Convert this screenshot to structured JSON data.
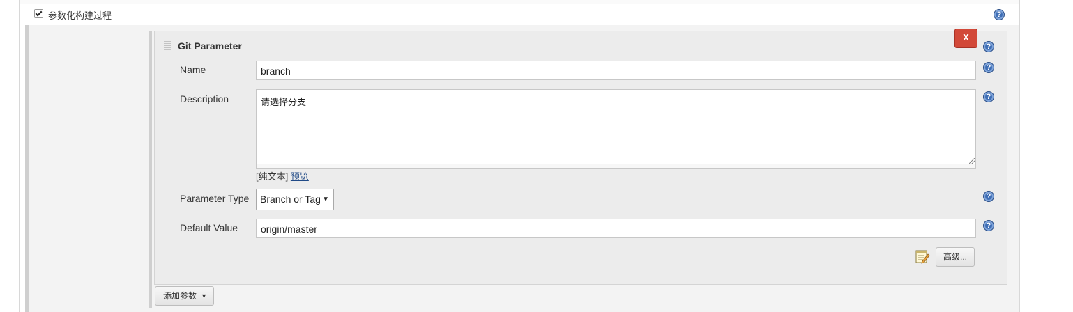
{
  "section": {
    "checkbox_label": "参数化构建过程",
    "checked": true
  },
  "parameter": {
    "title": "Git Parameter",
    "close_label": "X",
    "name_label": "Name",
    "name_value": "branch",
    "description_label": "Description",
    "description_value": "请选择分支",
    "format_prefix": "[纯文本]",
    "format_preview": "预览",
    "type_label": "Parameter Type",
    "type_value": "Branch or Tag",
    "default_label": "Default Value",
    "default_value": "origin/master",
    "advanced_label": "高级..."
  },
  "add_parameter_label": "添加参数",
  "help_icon_glyph": "?",
  "colors": {
    "close_button": "#d24939",
    "help_icon": "#3f6eb5",
    "link": "#204a87"
  }
}
